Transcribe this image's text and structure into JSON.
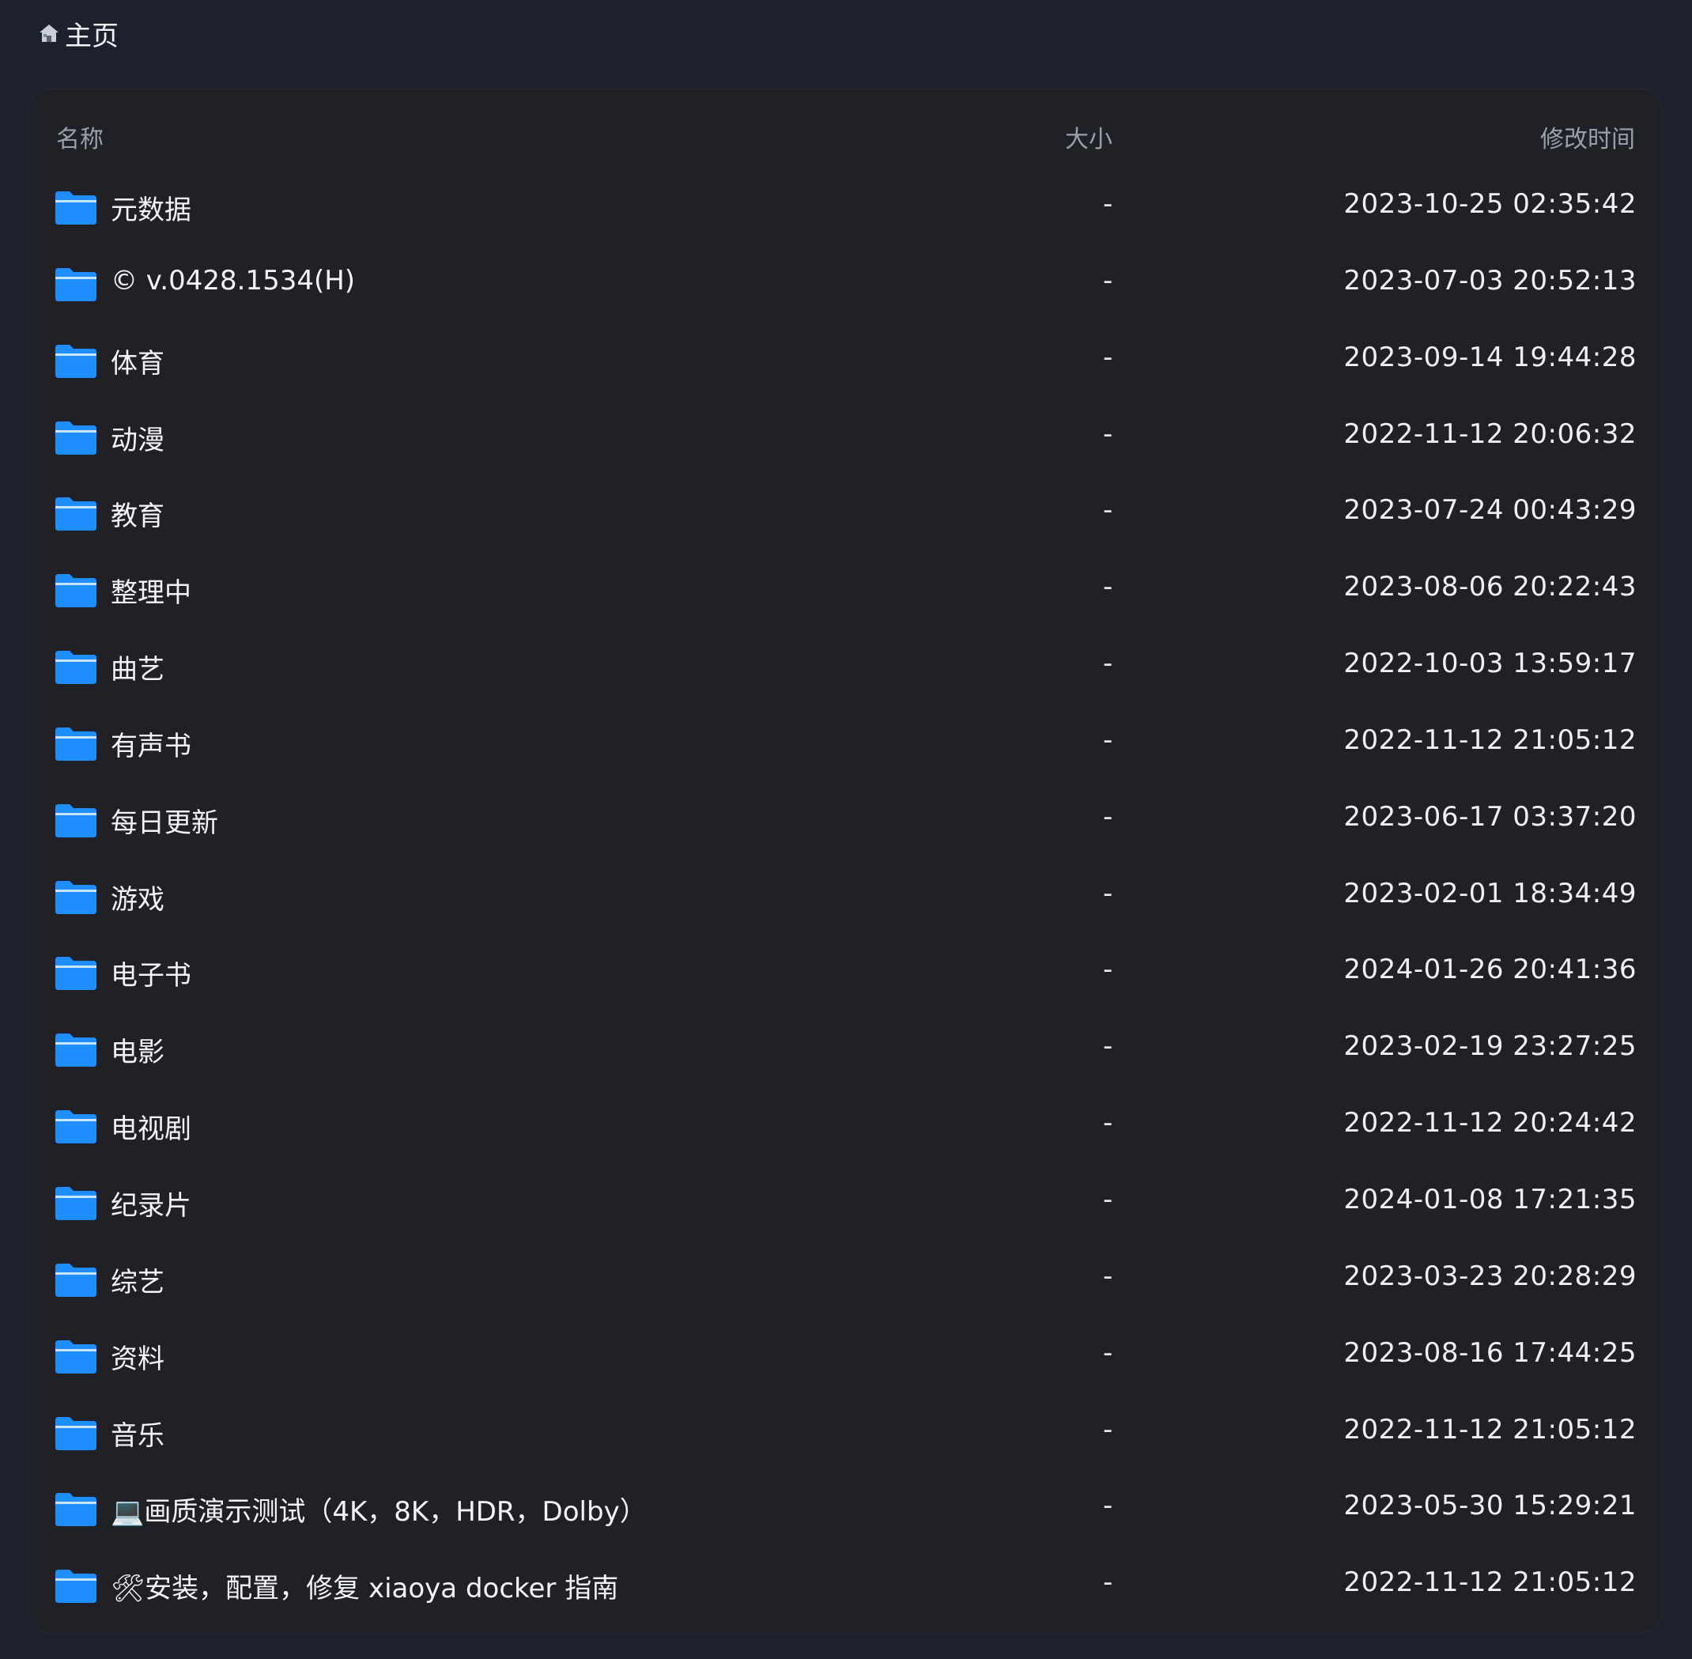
{
  "breadcrumb": {
    "icon": "home-icon",
    "label": "主页"
  },
  "table": {
    "headers": {
      "name": "名称",
      "size": "大小",
      "time": "修改时间"
    },
    "rows": [
      {
        "name": "元数据",
        "size": "-",
        "time": "2023-10-25 02:35:42"
      },
      {
        "name": "© v.0428.1534(H)",
        "size": "-",
        "time": "2023-07-03 20:52:13"
      },
      {
        "name": "体育",
        "size": "-",
        "time": "2023-09-14 19:44:28"
      },
      {
        "name": "动漫",
        "size": "-",
        "time": "2022-11-12 20:06:32"
      },
      {
        "name": "教育",
        "size": "-",
        "time": "2023-07-24 00:43:29"
      },
      {
        "name": "整理中",
        "size": "-",
        "time": "2023-08-06 20:22:43"
      },
      {
        "name": "曲艺",
        "size": "-",
        "time": "2022-10-03 13:59:17"
      },
      {
        "name": "有声书",
        "size": "-",
        "time": "2022-11-12 21:05:12"
      },
      {
        "name": "每日更新",
        "size": "-",
        "time": "2023-06-17 03:37:20"
      },
      {
        "name": "游戏",
        "size": "-",
        "time": "2023-02-01 18:34:49"
      },
      {
        "name": "电子书",
        "size": "-",
        "time": "2024-01-26 20:41:36"
      },
      {
        "name": "电影",
        "size": "-",
        "time": "2023-02-19 23:27:25"
      },
      {
        "name": "电视剧",
        "size": "-",
        "time": "2022-11-12 20:24:42"
      },
      {
        "name": "纪录片",
        "size": "-",
        "time": "2024-01-08 17:21:35"
      },
      {
        "name": "综艺",
        "size": "-",
        "time": "2023-03-23 20:28:29"
      },
      {
        "name": "资料",
        "size": "-",
        "time": "2023-08-16 17:44:25"
      },
      {
        "name": "音乐",
        "size": "-",
        "time": "2022-11-12 21:05:12"
      },
      {
        "name": "💻画质演示测试（4K，8K，HDR，Dolby）",
        "size": "-",
        "time": "2023-05-30 15:29:21"
      },
      {
        "name": "🛠安装，配置，修复 xiaoya docker 指南",
        "size": "-",
        "time": "2022-11-12 21:05:12"
      }
    ]
  },
  "colors": {
    "background": "#1c212d",
    "panel": "#1f2127",
    "folder_icon": "#1f8fff",
    "header_text": "#9aa0ab",
    "row_text": "#f2f4f8"
  }
}
